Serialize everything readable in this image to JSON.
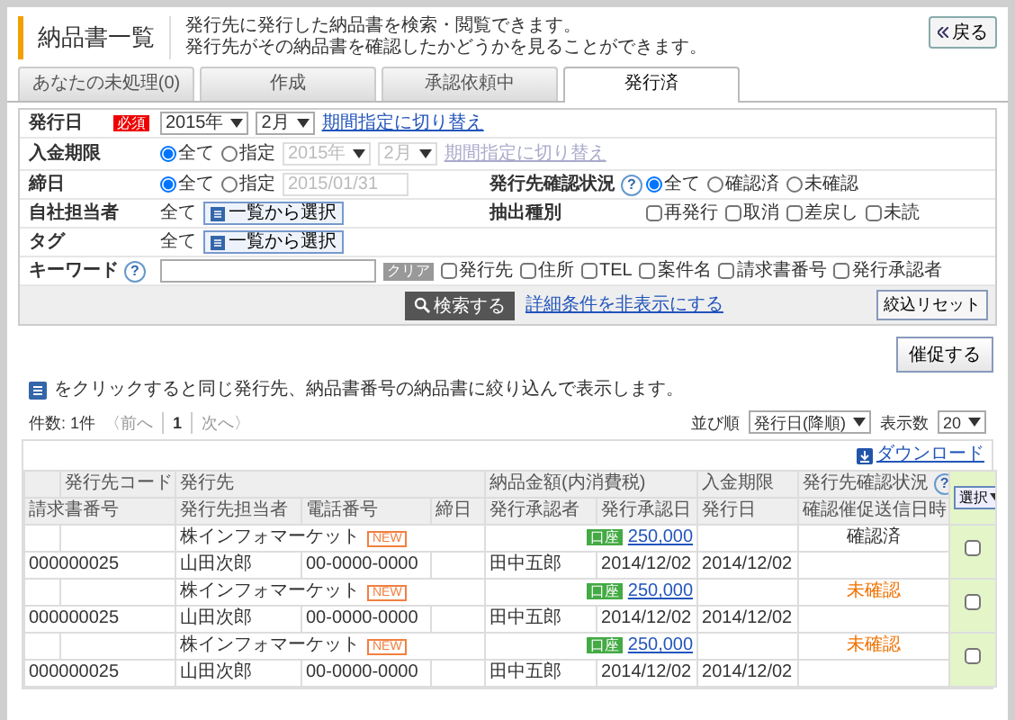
{
  "header": {
    "title": "納品書一覧",
    "description": [
      "発行先に発行した納品書を検索・閲覧できます。",
      "発行先がその納品書を確認したかどうかを見ることができます。"
    ],
    "back_button": "戻る"
  },
  "tabs": [
    {
      "label": "あなたの未処理(0)",
      "selected": false
    },
    {
      "label": "作成",
      "selected": false
    },
    {
      "label": "承認依頼中",
      "selected": false
    },
    {
      "label": "発行済",
      "selected": true
    }
  ],
  "search_form": {
    "issue_date": {
      "label": "発行日",
      "required_badge": "必須",
      "year": "2015年",
      "month": "2月",
      "toggle_link": "期間指定に切り替え"
    },
    "payment_due": {
      "label": "入金期限",
      "options": [
        {
          "label": "全て",
          "selected": true
        },
        {
          "label": "指定",
          "selected": false
        }
      ],
      "year": "2015年",
      "month": "2月",
      "toggle_link": "期間指定に切り替え",
      "disabled": true
    },
    "closing_date": {
      "label": "締日",
      "options": [
        {
          "label": "全て",
          "selected": true
        },
        {
          "label": "指定",
          "selected": false
        }
      ],
      "date": "2015/01/31"
    },
    "confirm_status": {
      "label": "発行先確認状況",
      "help": "?",
      "options": [
        {
          "label": "全て",
          "selected": true
        },
        {
          "label": "確認済",
          "selected": false
        },
        {
          "label": "未確認",
          "selected": false
        }
      ]
    },
    "staff": {
      "label": "自社担当者",
      "value": "全て",
      "button": "一覧から選択"
    },
    "extract_type": {
      "label": "抽出種別",
      "options": [
        {
          "label": "再発行",
          "checked": false
        },
        {
          "label": "取消",
          "checked": false
        },
        {
          "label": "差戻し",
          "checked": false
        },
        {
          "label": "未読",
          "checked": false
        }
      ]
    },
    "tag": {
      "label": "タグ",
      "value": "全て",
      "button": "一覧から選択"
    },
    "keyword": {
      "label": "キーワード",
      "help": "?",
      "clear_button": "クリア",
      "options": [
        {
          "label": "発行先",
          "checked": false
        },
        {
          "label": "住所",
          "checked": false
        },
        {
          "label": "TEL",
          "checked": false
        },
        {
          "label": "案件名",
          "checked": false
        },
        {
          "label": "請求書番号",
          "checked": false
        },
        {
          "label": "発行承認者",
          "checked": false
        }
      ]
    },
    "search_button": "検索する",
    "toggle_link": "詳細条件を非表示にする",
    "reset_button": "絞込リセット"
  },
  "remind_button": "催促する",
  "info_text": "をクリックすると同じ発行先、納品書番号の納品書に絞り込んで表示します。",
  "pager": {
    "count": "件数: 1件",
    "prev": "〈前へ",
    "page": "1",
    "next": "次へ〉",
    "sort_label": "並び順",
    "sort_value": "発行日(降順)",
    "per_page_label": "表示数",
    "per_page_value": "20"
  },
  "table": {
    "download_link": "ダウンロード",
    "select_button": "選択",
    "header_top": [
      "発行先コード",
      "発行先",
      "納品金額(内消費税)",
      "入金期限",
      "発行先確認状況"
    ],
    "header_bottom": [
      "請求書番号",
      "発行先担当者",
      "電話番号",
      "締日",
      "発行承認者",
      "発行承認日",
      "発行日",
      "確認催促送信日時"
    ],
    "help": "?",
    "rows": [
      {
        "company": "株インフォマーケット",
        "new_badge": "NEW",
        "amount_badge": "口座",
        "amount": "250,000",
        "status": "確認済",
        "confirmed": true,
        "invoice_no": "000000025",
        "contact": "山田次郎",
        "phone": "00-0000-0000",
        "approver": "田中五郎",
        "approved_date": "2014/12/02",
        "issue_date": "2014/12/02",
        "checked": false
      },
      {
        "company": "株インフォマーケット",
        "new_badge": "NEW",
        "amount_badge": "口座",
        "amount": "250,000",
        "status": "未確認",
        "confirmed": false,
        "invoice_no": "000000025",
        "contact": "山田次郎",
        "phone": "00-0000-0000",
        "approver": "田中五郎",
        "approved_date": "2014/12/02",
        "issue_date": "2014/12/02",
        "checked": false
      },
      {
        "company": "株インフォマーケット",
        "new_badge": "NEW",
        "amount_badge": "口座",
        "amount": "250,000",
        "status": "未確認",
        "confirmed": false,
        "invoice_no": "000000025",
        "contact": "山田次郎",
        "phone": "00-0000-0000",
        "approver": "田中五郎",
        "approved_date": "2014/12/02",
        "issue_date": "2014/12/02",
        "checked": false
      }
    ]
  }
}
